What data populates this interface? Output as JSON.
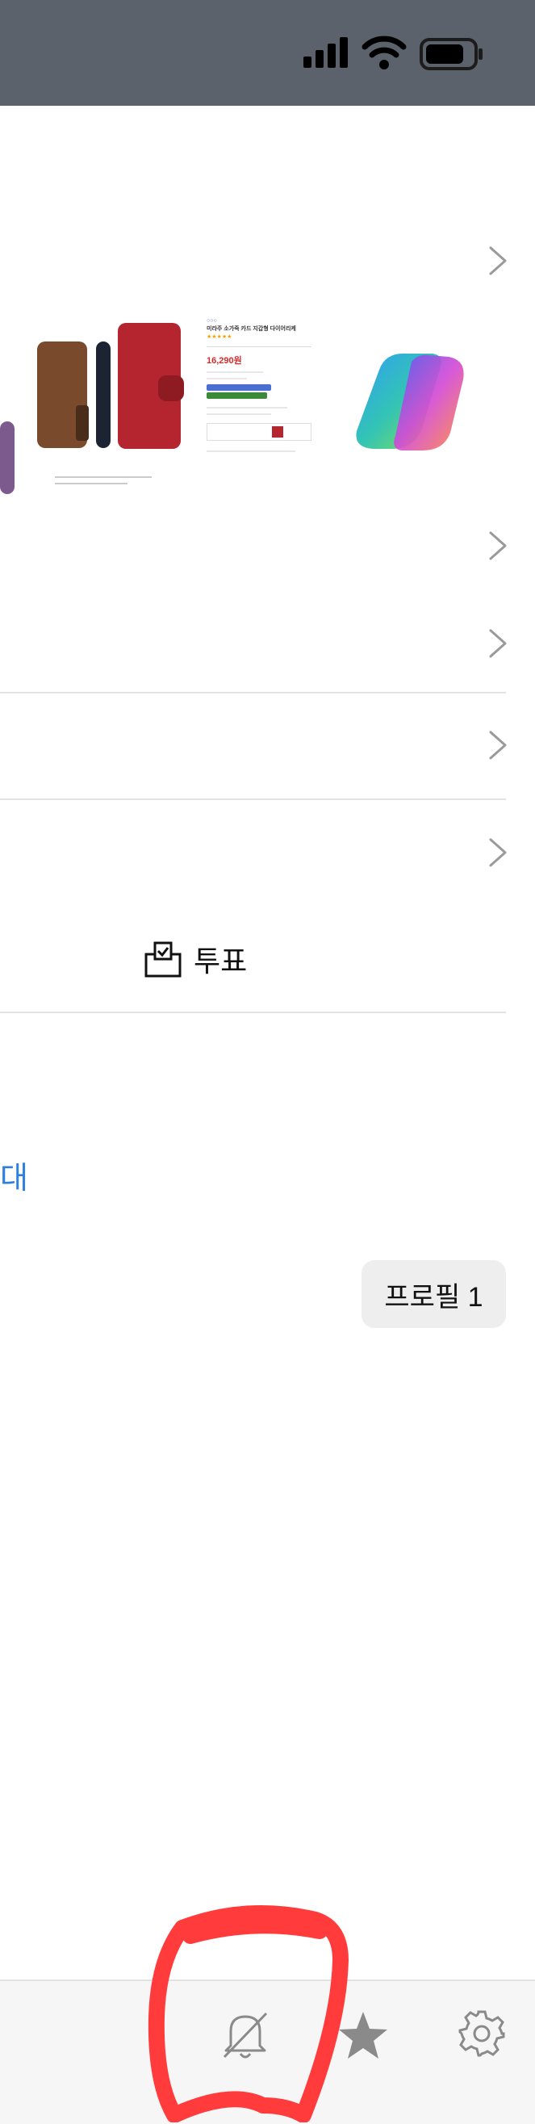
{
  "status_bar": {
    "signal_icon": "cellular-signal-icon",
    "wifi_icon": "wifi-icon",
    "battery_icon": "battery-icon"
  },
  "product_preview": {
    "title": "미라주 소가죽 카드 지갑형 다이어리케",
    "price": "16,290원"
  },
  "vote": {
    "label": "투표",
    "icon": "ballot-box-icon"
  },
  "expand_link": "대",
  "profile_chip": "프로필 1",
  "bottom_bar": {
    "notifications_icon": "bell-off-icon",
    "favorites_icon": "star-icon",
    "settings_icon": "gear-icon"
  },
  "colors": {
    "status_bar_bg": "#5b626c",
    "link_blue": "#2d7fe0",
    "annotation_red": "#ff3b3b"
  }
}
